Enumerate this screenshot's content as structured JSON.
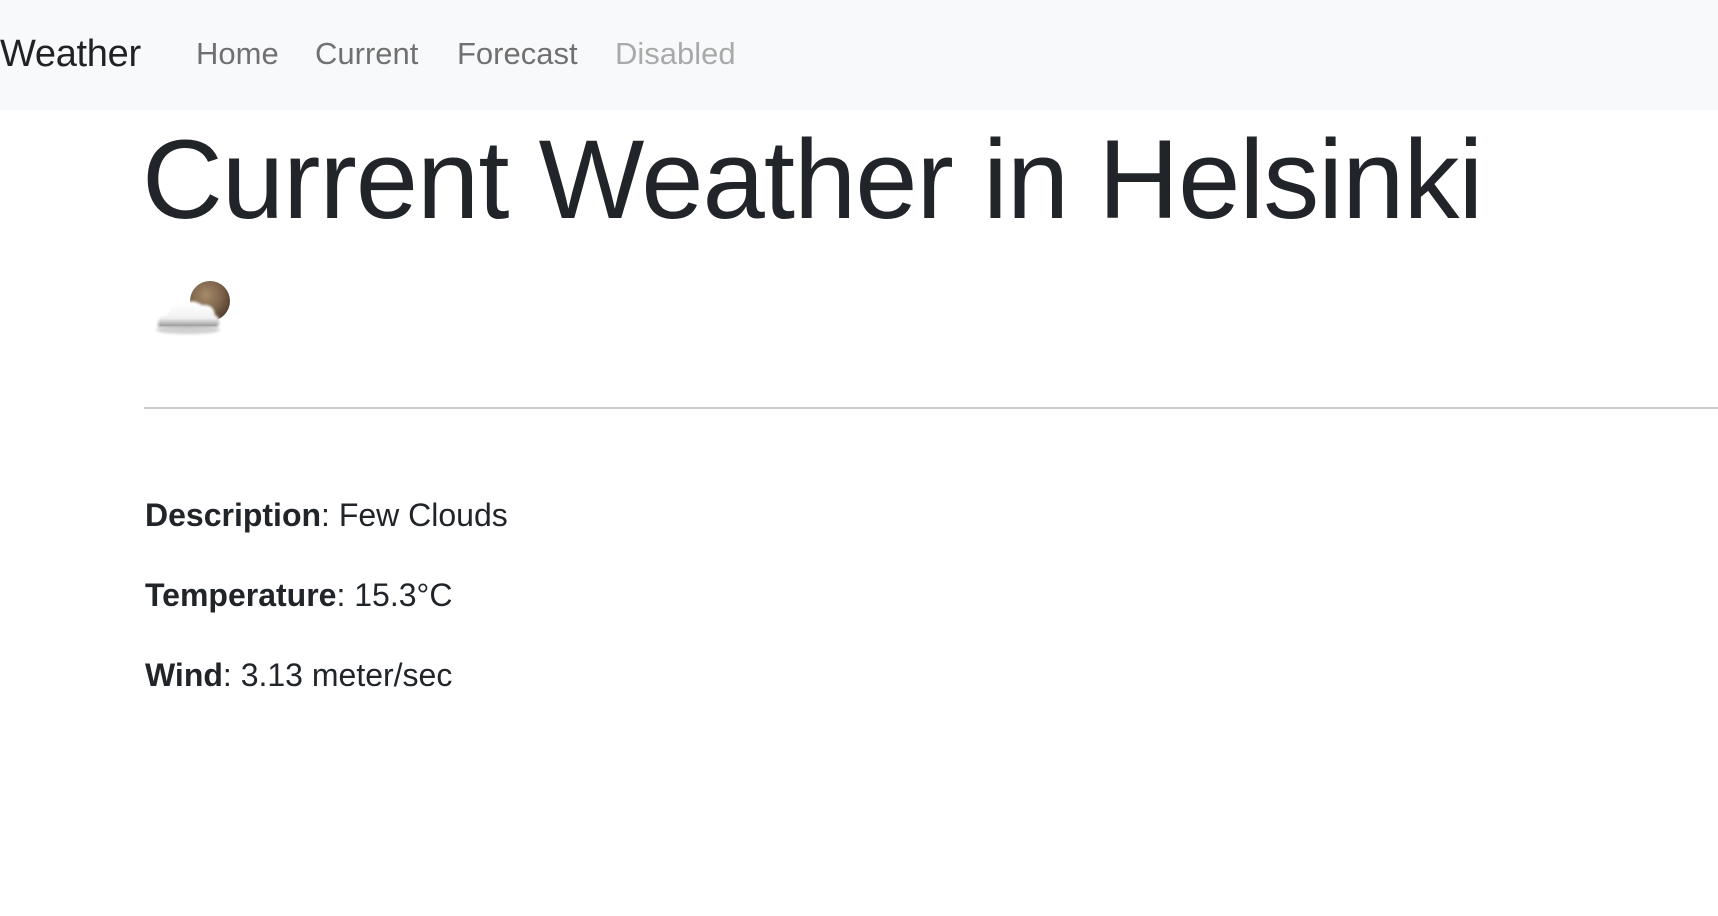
{
  "navbar": {
    "brand": "Weather",
    "links": [
      {
        "label": "Home",
        "state": "normal"
      },
      {
        "label": "Current",
        "state": "normal"
      },
      {
        "label": "Forecast",
        "state": "normal"
      },
      {
        "label": "Disabled",
        "state": "disabled"
      }
    ]
  },
  "main": {
    "title": "Current Weather in Helsinki",
    "icon": "few-clouds-night-icon",
    "details": {
      "description": {
        "label": "Description",
        "separator": ":",
        "value": " Few Clouds"
      },
      "temperature": {
        "label": "Temperature",
        "separator": ":",
        "value": " 15.3°C"
      },
      "wind": {
        "label": "Wind",
        "separator": ":",
        "value": " 3.13 meter/sec"
      }
    }
  },
  "colors": {
    "navbar_background": "#f8f9fa",
    "text": "#212529",
    "nav_link": "#737373",
    "nav_link_disabled": "#adadad",
    "divider": "#c8cacc"
  }
}
